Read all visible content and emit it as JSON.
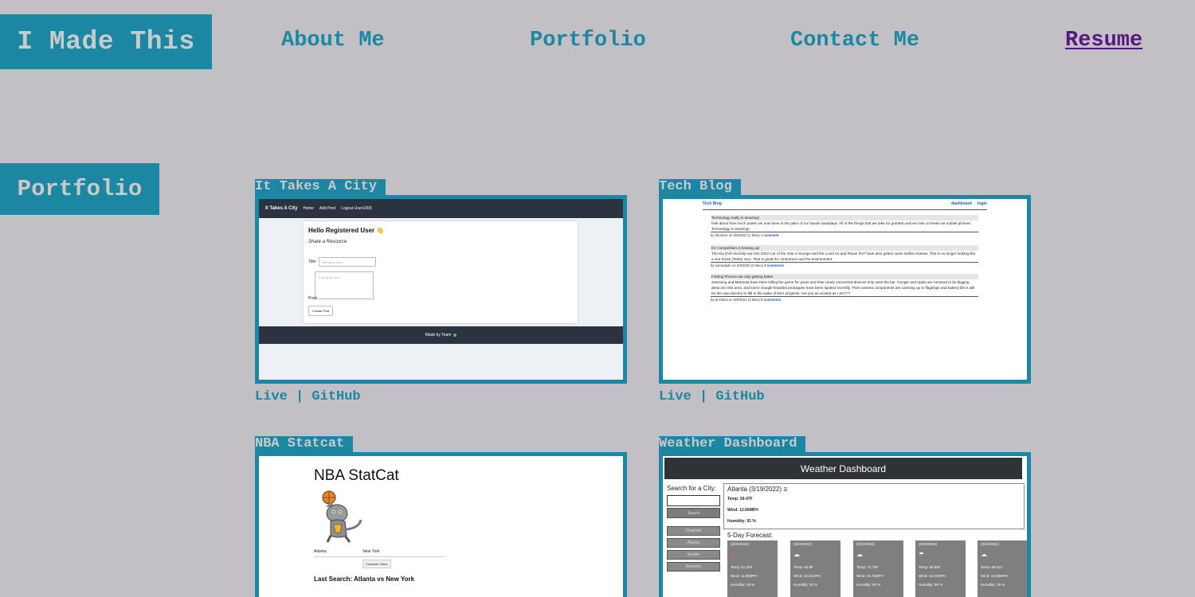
{
  "brand": "I Made This",
  "nav": {
    "about": "About Me",
    "portfolio": "Portfolio",
    "contact": "Contact Me",
    "resume": "Resume"
  },
  "section_title": "Portfolio",
  "projects": [
    {
      "title": "It Takes A City",
      "live": "Live",
      "separator": "|",
      "github": "GitHub"
    },
    {
      "title": "Tech Blog",
      "live": "Live",
      "separator": "|",
      "github": "GitHub"
    },
    {
      "title": "NBA Statcat"
    },
    {
      "title": "Weather Dashboard"
    }
  ],
  "colors": {
    "background": "#c2c0c4",
    "accent": "#1b87a3",
    "accent_text": "#c9cbcb",
    "visited_link": "#55197f"
  },
  "shot_itac": {
    "nav_brand": "It Takes A City",
    "nav_home": "Home",
    "nav_add": "Add Post",
    "nav_logout": "Logout User1000",
    "greeting": "Hello Registered User 👋",
    "subtitle": "Share a Resource",
    "title_label": "Title:",
    "title_placeholder": "Title goes here",
    "post_placeholder": "Post goes here",
    "post_label": "Post:",
    "create_button": "Create Post",
    "footer": "Made by Team"
  },
  "shot_blog": {
    "brand": "Tech Blog",
    "nav_dashboard": "dashboard",
    "nav_login": "login",
    "posts": [
      {
        "title": "Technology really is amazing!",
        "body": "hink about how much power we now have in the palm of our hands nowadays. All of the things that we take for granted until we lose or break our mobile phones. Technology is amazing!",
        "meta": "by faceless on 5/9/2022 (1 likes)",
        "comments": "1 comment"
      },
      {
        "title": "EV Competition is heating up!",
        "body": "The Kia EV6 recently won the 2022 Car of the Year in Europe and the Lucid Air and Rivian R1T have also gotten some stellar reviews. This is no longer looking like a one horse (Tesla) race. That is great for consumers and the environment.",
        "meta": "by somedude on 5/9/2022 (0 likes)",
        "comments": "3 comments"
      },
      {
        "title": "Folding Phones are only getting better",
        "body": "Samsung and Motorola have been killing the game for years and their newly uncovered devices only raise the bar. Google and Apple are rumored to be digging deep into this area, and some Google branded prototypes have been spotted recently. Their camera components are catching up to flagships and battery life is will be the next domino to fall in the wake of their progress. Are you as excited as I am???",
        "meta": "by techdiva on 5/9/2022 (3 likes)",
        "comments": "0 comments"
      }
    ]
  },
  "shot_nba": {
    "title": "NBA StatCat",
    "team_a": "Atlanta",
    "team_b": "New York",
    "compare": "Compare Cities",
    "last_search": "Last Search: Atlanta vs New York"
  },
  "shot_weather": {
    "title": "Weather Dashboard",
    "search_label": "Search for a City:",
    "search_button": "Search",
    "cities": [
      "Charlotte",
      "Atlanta",
      "Seattle",
      "Brooklyn"
    ],
    "current": {
      "heading": "Atlanta (3/19/2022)",
      "temp": "Temp: 59.47F",
      "wind": "Wind: 12.66MPH",
      "humidity": "Humidity: 91 %"
    },
    "forecast_label": "5-Day Forecast:",
    "forecast": [
      {
        "date": "(3/20/2022)",
        "icon": "sun-icon",
        "temp": "Temp: 61.25F",
        "wind": "Wind: 11.88MPH",
        "humidity": "Humidity: 26 %"
      },
      {
        "date": "(3/21/2022)",
        "icon": "cloud-icon",
        "temp": "Temp: 64.8F",
        "wind": "Wind: 10.31MPH",
        "humidity": "Humidity: 32 %"
      },
      {
        "date": "(3/22/2022)",
        "icon": "cloud-icon",
        "temp": "Temp: 71.78F",
        "wind": "Wind: 15.73MPH",
        "humidity": "Humidity: 50 %"
      },
      {
        "date": "(3/23/2022)",
        "icon": "rain-icon",
        "temp": "Temp: 66.88F",
        "wind": "Wind: 16.67MPH",
        "humidity": "Humidity: 89 %"
      },
      {
        "date": "(3/24/2022)",
        "icon": "cloud-icon",
        "temp": "Temp: 66.61F",
        "wind": "Wind: 10.98MPH",
        "humidity": "Humidity: 46 %"
      }
    ]
  }
}
